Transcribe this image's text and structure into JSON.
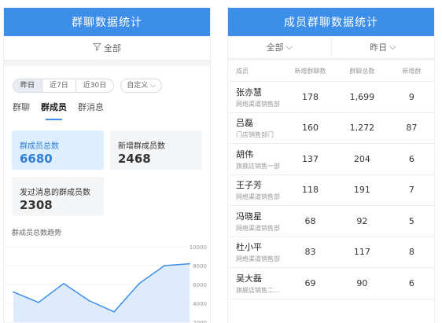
{
  "left": {
    "header": "群聊数据统计",
    "filter": "全部",
    "date_range": [
      "昨日",
      "近7日",
      "近30日"
    ],
    "custom_label": "自定义",
    "tabs": [
      "群聊",
      "群成员",
      "群消息"
    ],
    "cards": [
      {
        "label": "群成员总数",
        "value": "6680"
      },
      {
        "label": "新增群成员数",
        "value": "2468"
      },
      {
        "label": "发过消息的群成员数",
        "value": "2308"
      }
    ],
    "trend_title": "群成员总数趋势",
    "chart_data": {
      "type": "area",
      "title": "",
      "x": [
        1,
        2,
        3,
        4,
        5,
        6,
        7,
        8
      ],
      "y": [
        5200,
        4100,
        6100,
        4300,
        3100,
        6100,
        8000,
        8200
      ],
      "ylim": [
        2000,
        10000
      ],
      "yticks": [
        "10000",
        "8000",
        "6000",
        "4000",
        "2000"
      ],
      "line_color": "#3d8ee9",
      "fill_color": "#d4e6fb"
    }
  },
  "right": {
    "header": "成员群聊数据统计",
    "filter_left": "全部",
    "filter_right": "昨日",
    "columns": [
      "成员",
      "新增群聊数",
      "群聊总数",
      "新增群"
    ],
    "rows": [
      {
        "name": "张亦慧",
        "dept": "网络渠道销售部",
        "a": "178",
        "b": "1,699",
        "c": "9"
      },
      {
        "name": "吕磊",
        "dept": "门店销售部门",
        "a": "160",
        "b": "1,272",
        "c": "87"
      },
      {
        "name": "胡伟",
        "dept": "旗舰店销售一部",
        "a": "137",
        "b": "204",
        "c": "6"
      },
      {
        "name": "王子芳",
        "dept": "网络渠道销售部",
        "a": "118",
        "b": "191",
        "c": "7"
      },
      {
        "name": "冯晓星",
        "dept": "网络渠道销售部",
        "a": "68",
        "b": "92",
        "c": "5"
      },
      {
        "name": "杜小平",
        "dept": "网络渠道销售部",
        "a": "83",
        "b": "117",
        "c": "8"
      },
      {
        "name": "吴大磊",
        "dept": "旗舰店销售二...",
        "a": "69",
        "b": "90",
        "c": "6"
      }
    ]
  }
}
